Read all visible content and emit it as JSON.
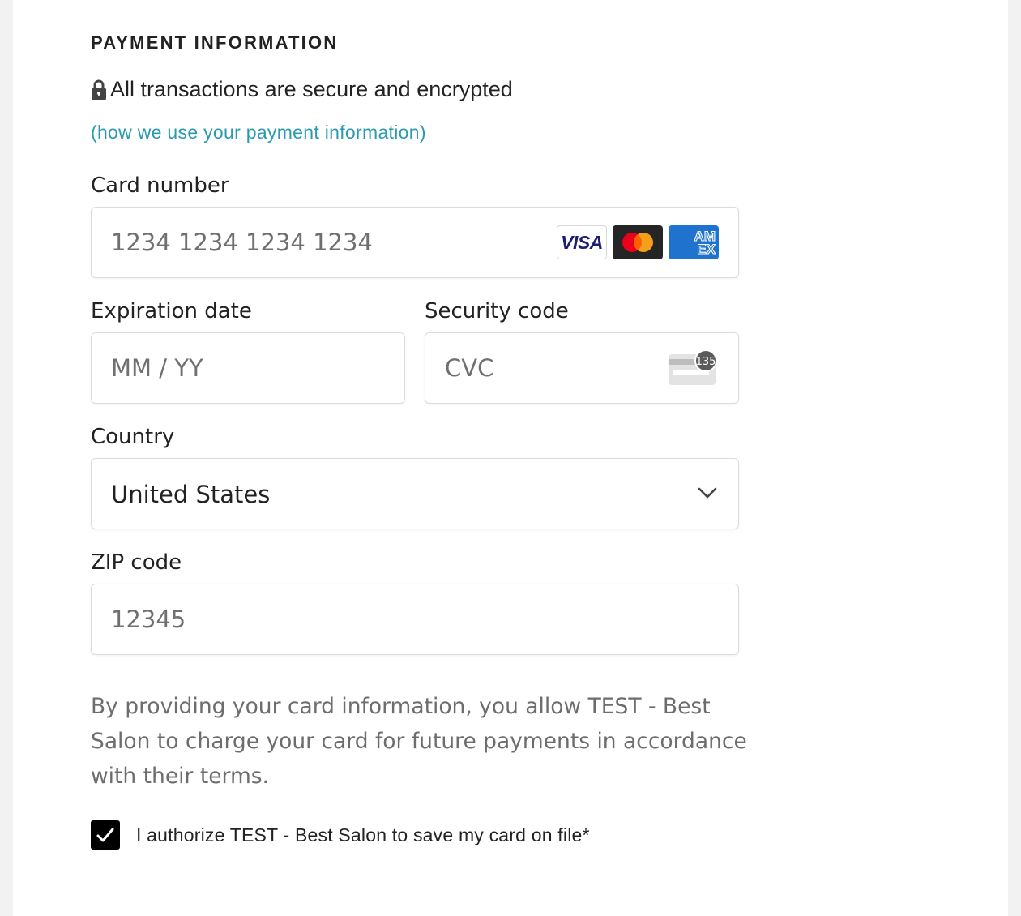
{
  "section": {
    "title": "PAYMENT INFORMATION",
    "secure_text": "All transactions are secure and encrypted",
    "info_link": "(how we use your payment information)"
  },
  "card_number": {
    "label": "Card number",
    "placeholder": "1234 1234 1234 1234",
    "brands": [
      "VISA",
      "mastercard-icon",
      "AMEX"
    ],
    "visa_text": "VISA",
    "amex_text": "AM\nEX"
  },
  "expiration": {
    "label": "Expiration date",
    "placeholder": "MM / YY"
  },
  "security_code": {
    "label": "Security code",
    "placeholder": "CVC",
    "icon_badge": "135"
  },
  "country": {
    "label": "Country",
    "value": "United States"
  },
  "zip": {
    "label": "ZIP code",
    "placeholder": "12345"
  },
  "disclaimer": "By providing your card information, you allow TEST - Best Salon to charge your card for future payments in accordance with their terms.",
  "authorization": {
    "label": "I authorize TEST - Best Salon to save my card on file*",
    "checked": true
  },
  "colors": {
    "link": "#2a9ab0",
    "visa": "#1a1f71",
    "amex": "#1f72cd",
    "mc_red": "#eb001b",
    "mc_orange": "#f79e1b"
  }
}
